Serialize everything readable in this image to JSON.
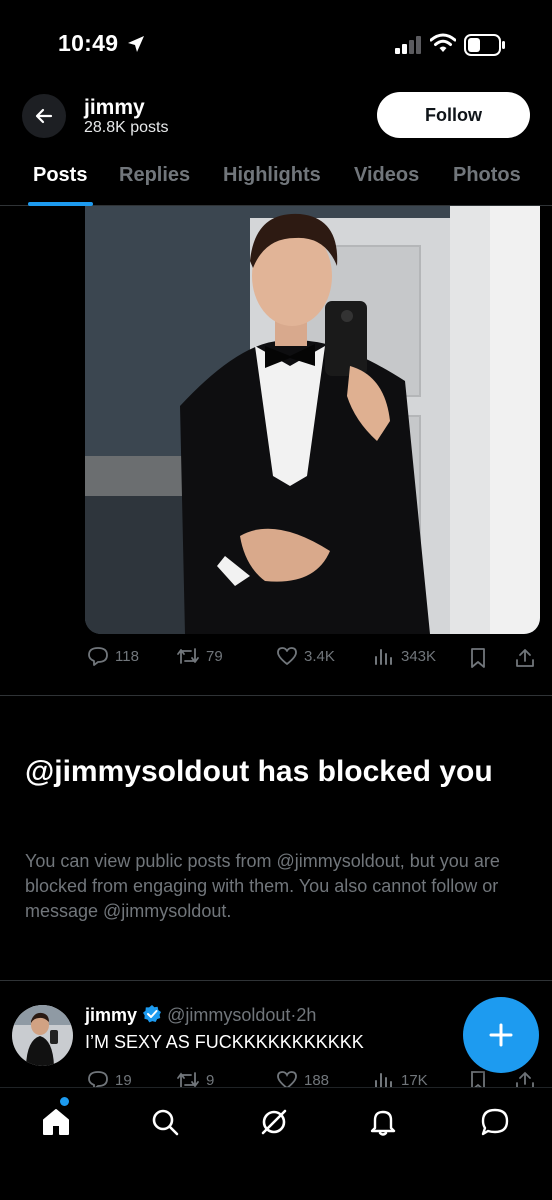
{
  "status_bar": {
    "time": "10:49"
  },
  "header": {
    "name": "jimmy",
    "posts": "28.8K posts",
    "follow_label": "Follow"
  },
  "tabs": [
    {
      "label": "Posts",
      "active": true
    },
    {
      "label": "Replies",
      "active": false
    },
    {
      "label": "Highlights",
      "active": false
    },
    {
      "label": "Videos",
      "active": false
    },
    {
      "label": "Photos",
      "active": false
    }
  ],
  "post1": {
    "image_desc_icon": "photo",
    "replies": "118",
    "reposts": "79",
    "likes": "3.4K",
    "views": "343K"
  },
  "blocked": {
    "title": "@jimmysoldout has blocked you",
    "body": "You can view public posts from @jimmysoldout, but you are blocked from engaging with them. You also cannot follow or message @jimmysoldout."
  },
  "tweet": {
    "name": "jimmy",
    "handle": "@jimmysoldout",
    "time": "2h",
    "text": "I’M SEXY AS FUCKKKKKKKKKKK",
    "replies": "19",
    "reposts": "9",
    "likes": "188",
    "views": "17K"
  },
  "colors": {
    "accent": "#1d9bf0",
    "muted": "#71767b",
    "background": "#000000"
  },
  "bottom_nav": [
    "home-icon",
    "search-icon",
    "grok-icon",
    "notifications-icon",
    "messages-icon"
  ]
}
